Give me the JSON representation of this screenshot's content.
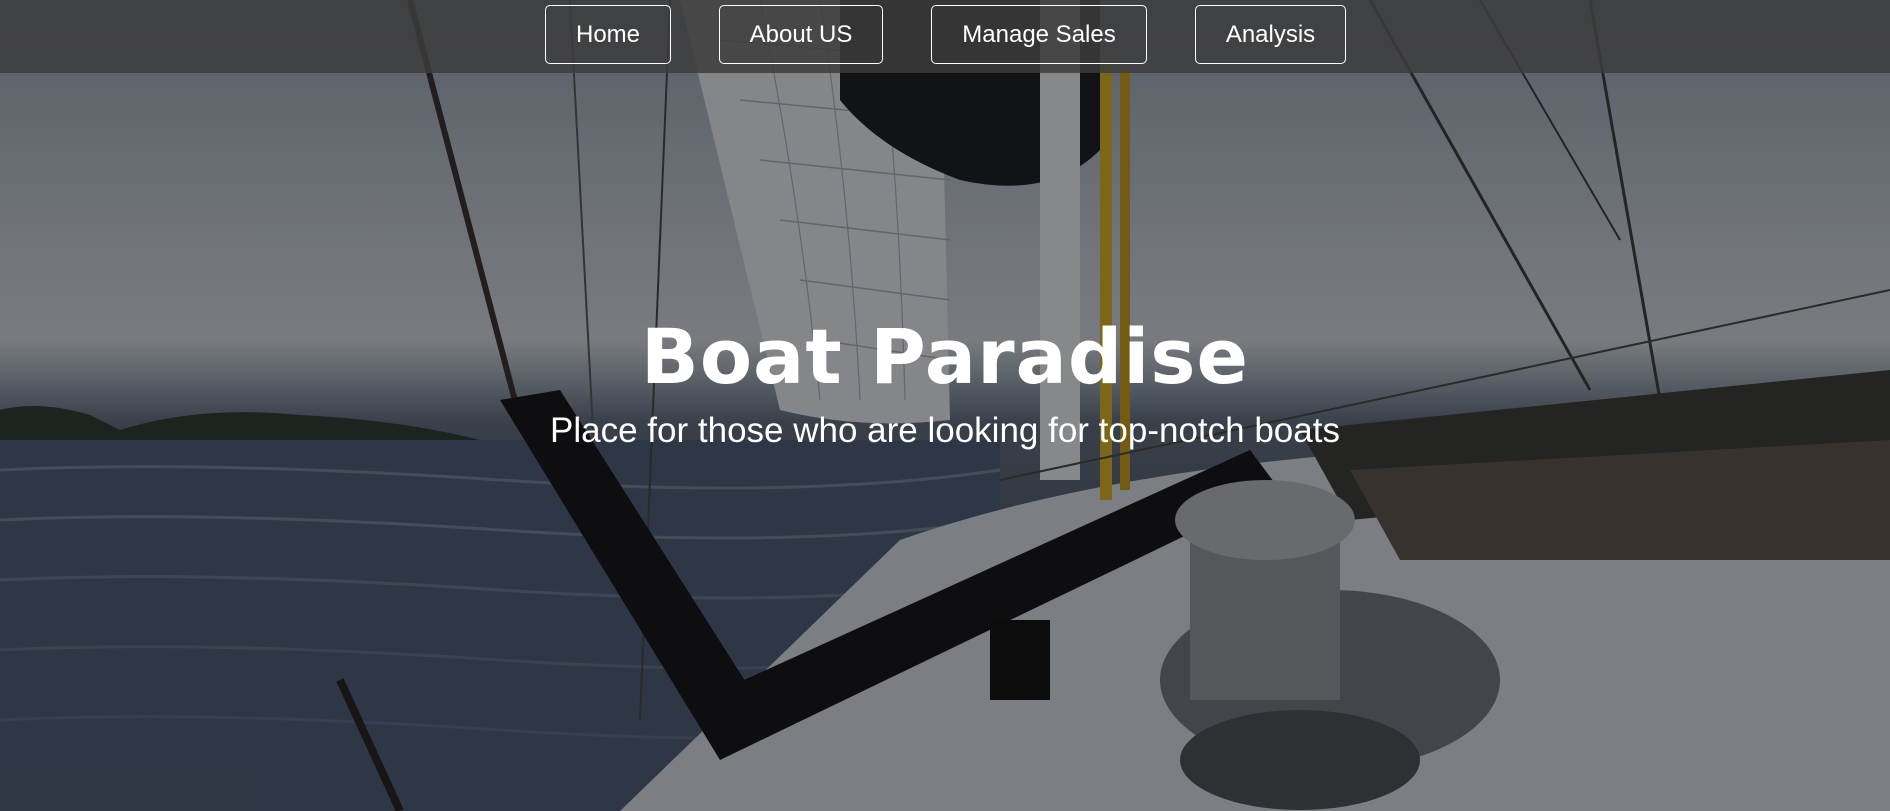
{
  "nav": {
    "items": [
      {
        "label": "Home"
      },
      {
        "label": "About US"
      },
      {
        "label": "Manage Sales"
      },
      {
        "label": "Analysis"
      }
    ]
  },
  "hero": {
    "title": "Boat Paradise",
    "subtitle": "Place for those who are looking for top-notch boats",
    "background_image": "sailboat-deck-photo"
  },
  "colors": {
    "text": "#ffffff",
    "nav_background": "#3c3c3c",
    "nav_border": "#ffffff"
  }
}
